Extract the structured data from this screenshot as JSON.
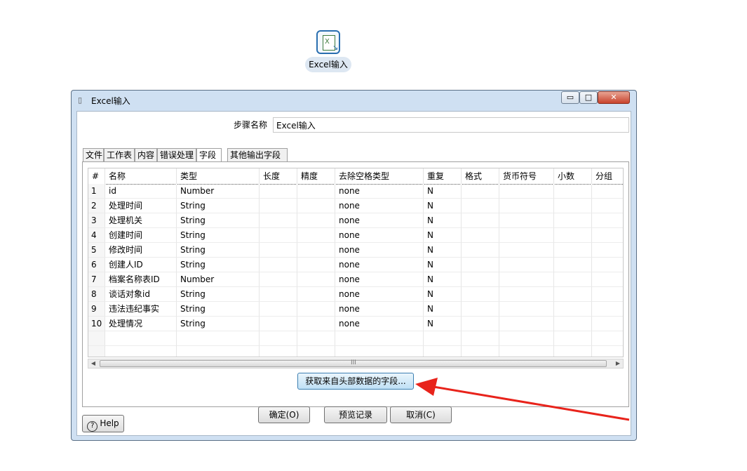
{
  "canvas": {
    "step_label": "Excel输入",
    "step_icon_glyph": "X",
    "step_icon": "excel-input-step-icon"
  },
  "dialog": {
    "title": "Excel输入",
    "title_icon": "step-icon",
    "min_glyph": "▭",
    "max_glyph": "□",
    "close_glyph": "✕",
    "step_name_label": "步骤名称",
    "step_name_value": "Excel输入",
    "tabs": [
      {
        "label": "文件"
      },
      {
        "label": "工作表"
      },
      {
        "label": "内容"
      },
      {
        "label": "错误处理"
      },
      {
        "label": "字段"
      },
      {
        "label": "其他输出字段"
      }
    ],
    "active_tab": "字段",
    "table": {
      "columns": [
        "#",
        "名称",
        "类型",
        "长度",
        "精度",
        "去除空格类型",
        "重复",
        "格式",
        "货币符号",
        "小数",
        "分组"
      ],
      "rows": [
        {
          "n": "1",
          "name": "id",
          "type": "Number",
          "trim": "none",
          "repeat": "N"
        },
        {
          "n": "2",
          "name": "处理时间",
          "type": "String",
          "trim": "none",
          "repeat": "N"
        },
        {
          "n": "3",
          "name": "处理机关",
          "type": "String",
          "trim": "none",
          "repeat": "N"
        },
        {
          "n": "4",
          "name": "创建时间",
          "type": "String",
          "trim": "none",
          "repeat": "N"
        },
        {
          "n": "5",
          "name": "修改时间",
          "type": "String",
          "trim": "none",
          "repeat": "N"
        },
        {
          "n": "6",
          "name": "创建人ID",
          "type": "String",
          "trim": "none",
          "repeat": "N"
        },
        {
          "n": "7",
          "name": "档案名称表ID",
          "type": "Number",
          "trim": "none",
          "repeat": "N"
        },
        {
          "n": "8",
          "name": "谈话对象id",
          "type": "String",
          "trim": "none",
          "repeat": "N"
        },
        {
          "n": "9",
          "name": "违法违纪事实",
          "type": "String",
          "trim": "none",
          "repeat": "N"
        },
        {
          "n": "10",
          "name": "处理情况",
          "type": "String",
          "trim": "none",
          "repeat": "N"
        }
      ]
    },
    "scroll_left_glyph": "◀",
    "scroll_right_glyph": "▶",
    "scroll_grip": "III",
    "get_fields_button": "获取来自头部数据的字段...",
    "help_button": "Help",
    "help_glyph": "?",
    "ok_button": "确定(O)",
    "preview_button": "预览记录",
    "cancel_button": "取消(C)"
  },
  "colors": {
    "window_frame": "#cfe0f2",
    "annotation_arrow": "#e8231b",
    "get_fields_button_border": "#3c7fb1"
  }
}
